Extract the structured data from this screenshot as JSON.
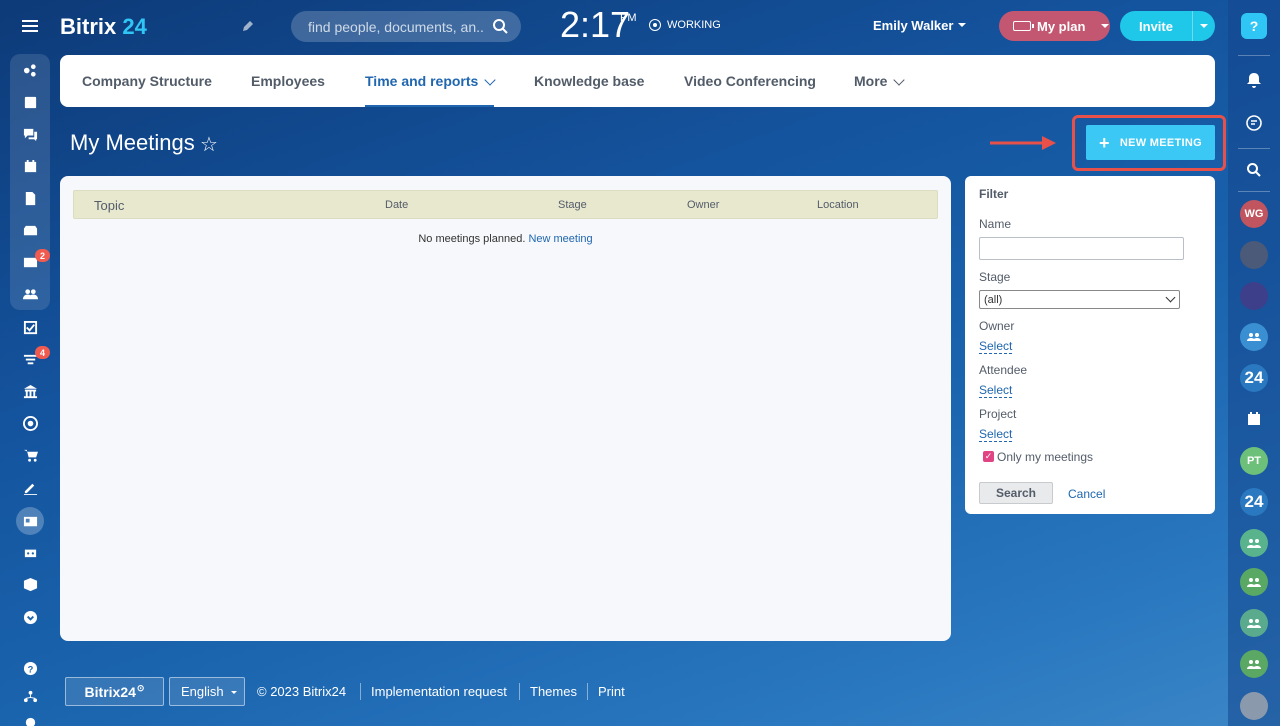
{
  "header": {
    "logo_text": "Bitrix",
    "logo_num": "24",
    "search_placeholder": "find people, documents, an...",
    "clock_time": "2:17",
    "clock_ampm": "PM",
    "work_status": "WORKING",
    "user_name": "Emily Walker",
    "my_plan_label": "My plan",
    "invite_label": "Invite"
  },
  "left_sidebar": {
    "badges": {
      "mail": "2",
      "funnel": "4"
    }
  },
  "right_sidebar": {
    "help_label": "?",
    "avatars": [
      "WG",
      "PT"
    ],
    "bitrix_24": "24"
  },
  "nav": {
    "items": [
      {
        "label": "Company Structure"
      },
      {
        "label": "Employees"
      },
      {
        "label": "Time and reports"
      },
      {
        "label": "Knowledge base"
      },
      {
        "label": "Video Conferencing"
      },
      {
        "label": "More"
      }
    ],
    "active_index": 2
  },
  "page": {
    "title": "My Meetings",
    "new_meeting_label": "NEW MEETING"
  },
  "table": {
    "columns": [
      "Topic",
      "Date",
      "Stage",
      "Owner",
      "Location"
    ],
    "empty_text": "No meetings planned.",
    "empty_link": "New meeting"
  },
  "filter": {
    "title": "Filter",
    "name_label": "Name",
    "name_value": "",
    "stage_label": "Stage",
    "stage_value": "(all)",
    "owner_label": "Owner",
    "attendee_label": "Attendee",
    "project_label": "Project",
    "select_link": "Select",
    "only_my_label": "Only my meetings",
    "only_my_checked": true,
    "search_button": "Search",
    "cancel_link": "Cancel"
  },
  "footer": {
    "logo": "Bitrix24",
    "language": "English",
    "copyright": "© 2023 Bitrix24",
    "implementation": "Implementation request",
    "themes": "Themes",
    "print": "Print"
  },
  "colors": {
    "accent": "#2fc6f6",
    "link": "#2067b0",
    "highlight": "#e8514a",
    "plan": "#c35670"
  }
}
